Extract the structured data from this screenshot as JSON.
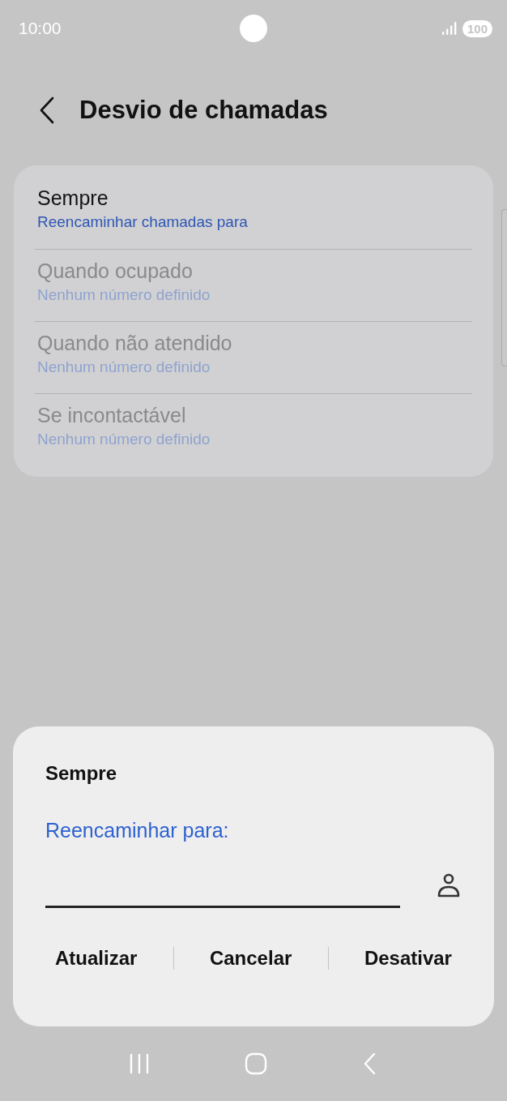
{
  "status_bar": {
    "time": "10:00",
    "battery": "100"
  },
  "header": {
    "title": "Desvio de chamadas"
  },
  "options": [
    {
      "title": "Sempre",
      "subtitle": "Reencaminhar chamadas para",
      "disabled": false
    },
    {
      "title": "Quando ocupado",
      "subtitle": "Nenhum número definido",
      "disabled": true
    },
    {
      "title": "Quando não atendido",
      "subtitle": "Nenhum número definido",
      "disabled": true
    },
    {
      "title": "Se incontactável",
      "subtitle": "Nenhum número definido",
      "disabled": true
    }
  ],
  "dialog": {
    "title": "Sempre",
    "label": "Reencaminhar para:",
    "buttons": [
      "Atualizar",
      "Cancelar",
      "Desativar"
    ]
  }
}
